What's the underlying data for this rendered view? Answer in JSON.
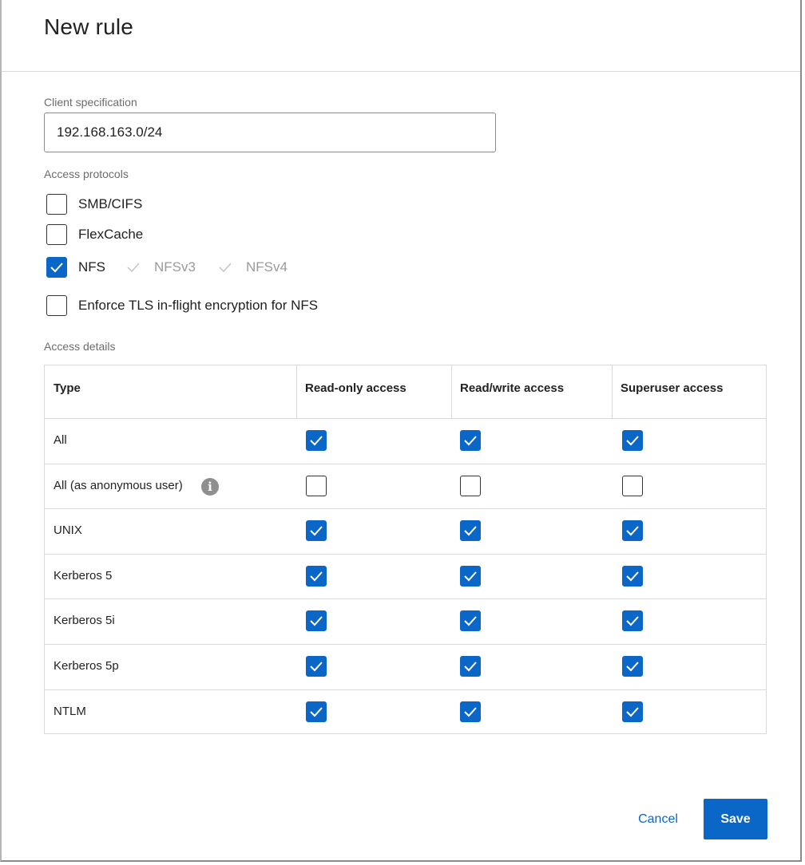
{
  "dialog": {
    "title": "New rule",
    "cancel_label": "Cancel",
    "save_label": "Save",
    "accent_color": "#0a67c8"
  },
  "client_spec": {
    "label": "Client specification",
    "value": "192.168.163.0/24"
  },
  "access_protocols": {
    "label": "Access protocols",
    "options": [
      {
        "label": "SMB/CIFS",
        "checked": false
      },
      {
        "label": "FlexCache",
        "checked": false
      },
      {
        "label": "NFS",
        "checked": true
      },
      {
        "label": "NFSv3",
        "checked": true,
        "disabled": true
      },
      {
        "label": "NFSv4",
        "checked": true,
        "disabled": true
      },
      {
        "label": "Enforce TLS in-flight encryption for NFS",
        "checked": false
      }
    ]
  },
  "access_details": {
    "label": "Access details",
    "columns": [
      "Type",
      "Read-only access",
      "Read/write access",
      "Superuser access"
    ],
    "rows": [
      {
        "type": "All",
        "read_only": true,
        "read_write": true,
        "superuser": true
      },
      {
        "type": "All (as anonymous user)",
        "info_icon": "info-icon",
        "read_only": false,
        "read_write": false,
        "superuser": false
      },
      {
        "type": "UNIX",
        "read_only": true,
        "read_write": true,
        "superuser": true
      },
      {
        "type": "Kerberos 5",
        "read_only": true,
        "read_write": true,
        "superuser": true
      },
      {
        "type": "Kerberos 5i",
        "read_only": true,
        "read_write": true,
        "superuser": true
      },
      {
        "type": "Kerberos 5p",
        "read_only": true,
        "read_write": true,
        "superuser": true
      },
      {
        "type": "NTLM",
        "read_only": true,
        "read_write": true,
        "superuser": true
      }
    ]
  }
}
